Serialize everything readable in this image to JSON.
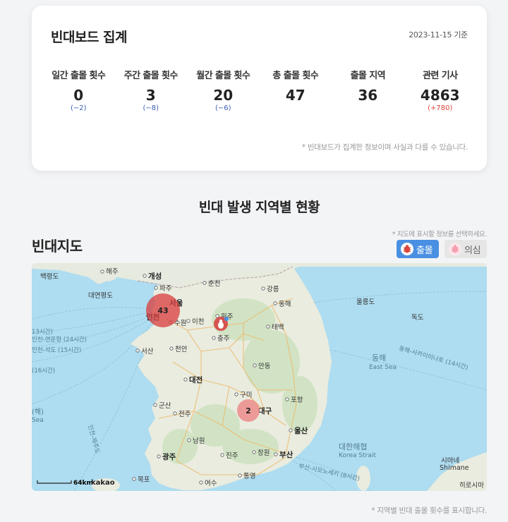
{
  "summary": {
    "title": "빈대보드 집계",
    "date": "2023-11-15 기준",
    "stats": [
      {
        "label": "일간 출몰 횟수",
        "value": "0",
        "delta": "(−2)",
        "trend": "down"
      },
      {
        "label": "주간 출몰 횟수",
        "value": "3",
        "delta": "(−8)",
        "trend": "down"
      },
      {
        "label": "월간 출몰 횟수",
        "value": "20",
        "delta": "(−6)",
        "trend": "down"
      },
      {
        "label": "총 출몰 횟수",
        "value": "47",
        "delta": "",
        "trend": ""
      },
      {
        "label": "출몰 지역",
        "value": "36",
        "delta": "",
        "trend": ""
      },
      {
        "label": "관련 기사",
        "value": "4863",
        "delta": "(+780)",
        "trend": "up"
      }
    ],
    "note": "* 빈대보드가 집계한 정보이며 사실과 다를 수 있습니다."
  },
  "section_title": "빈대 발생 지역별 현황",
  "map_section": {
    "heading": "빈대지도",
    "hint": "* 지도에 표시할 정보를 선택하세요.",
    "filters": [
      {
        "label": "출몰",
        "active": true,
        "icon": "bedbug-icon"
      },
      {
        "label": "의심",
        "active": false,
        "icon": "bedbug-icon"
      }
    ],
    "clusters": [
      {
        "count": "43",
        "region": "서울"
      },
      {
        "count": "2",
        "region": "대구"
      }
    ],
    "single_marker_region": "원주",
    "cities": {
      "kaesong": "개성",
      "haeju": "해주",
      "baengnyeong": "백령도",
      "yeonpyeong": "대연평도",
      "paju": "파주",
      "chuncheon": "춘천",
      "gangneung": "강릉",
      "donghae": "동해",
      "seoul": "서울",
      "incheon": "인천",
      "suwon": "수원",
      "icheon": "이천",
      "wonju": "원주",
      "taebaek": "태백",
      "chungju": "충주",
      "cheonan": "천안",
      "seosan": "서산",
      "andong": "안동",
      "daejeon": "대전",
      "gumi": "구미",
      "pohang": "포항",
      "gunsan": "군산",
      "jeonju": "전주",
      "daegu": "대구",
      "ulsan": "울산",
      "namwon": "남원",
      "changwon": "창원",
      "busan": "부산",
      "gwangju": "광주",
      "jinju": "진주",
      "mokpo": "목포",
      "yeosu": "여수",
      "tongyeong": "통영",
      "ulleung": "울릉도",
      "dokdo": "독도",
      "shimane": "시마네",
      "shimane_en": "Shimane",
      "hiroshima": "히로시마"
    },
    "seas": {
      "east_sea": "동해",
      "east_sea_en": "East Sea",
      "korea_strait": "대한해협",
      "korea_strait_en": "Korea Strait",
      "west_sea": "(해)",
      "west_sea_en": "Sea"
    },
    "routes": {
      "r1": "13시간)",
      "r2": "인천-연운항 (24시간)",
      "r3": "인천-석도 (15시간)",
      "r4": "(16시간)",
      "r5": "동해-사카이미나토 (14시간)",
      "r6": "부산-시모노세키 (8시간)",
      "r7": "인천-제주도"
    },
    "scale": "64km",
    "brand": "kakao"
  },
  "bottom_note": "* 지역별 빈대 출몰 횟수를 표시합니다.",
  "colors": {
    "accent": "#4a90e2",
    "cluster": "#d83c3c",
    "delta_down": "#3a5fb5",
    "delta_up": "#d9453a"
  }
}
